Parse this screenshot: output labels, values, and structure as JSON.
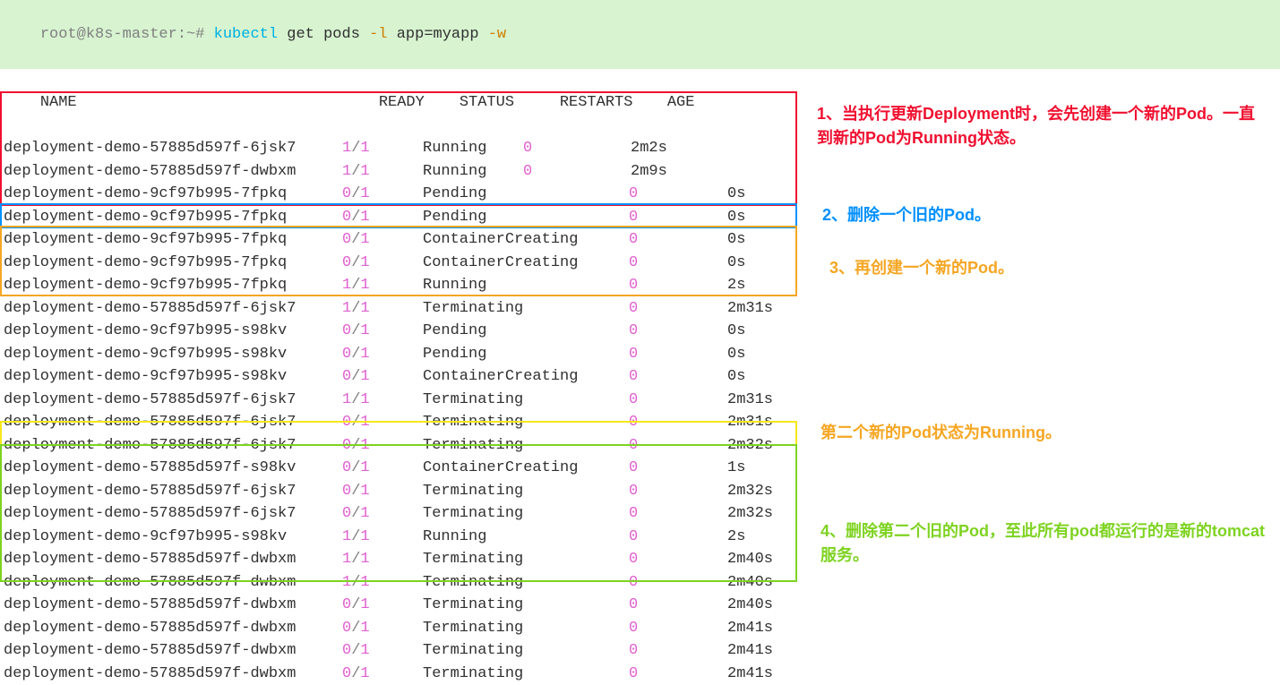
{
  "cmd_line": {
    "prompt_user": "root@k8s-master",
    "prompt_path": ":~# ",
    "cmd_kubectl": "kubectl",
    "cmd_args": " get pods ",
    "cmd_flag1": "-l",
    "cmd_args2": " app=myapp ",
    "cmd_flag2": "-w"
  },
  "headers": {
    "name": "NAME",
    "ready": "READY",
    "status": "STATUS",
    "restarts": "RESTARTS",
    "age": "AGE"
  },
  "rows_top": [
    {
      "name": "deployment-demo-57885d597f-6jsk7",
      "r1": "1",
      "r2": "1",
      "status": "Running",
      "restarts": "0",
      "age": "2m2s"
    },
    {
      "name": "deployment-demo-57885d597f-dwbxm",
      "r1": "1",
      "r2": "1",
      "status": "Running",
      "restarts": "0",
      "age": "2m9s"
    }
  ],
  "rows_wide": [
    {
      "name": "deployment-demo-9cf97b995-7fpkq",
      "r1": "0",
      "r2": "1",
      "status": "Pending",
      "restarts": "0",
      "age": "0s"
    },
    {
      "name": "deployment-demo-9cf97b995-7fpkq",
      "r1": "0",
      "r2": "1",
      "status": "Pending",
      "restarts": "0",
      "age": "0s"
    },
    {
      "name": "deployment-demo-9cf97b995-7fpkq",
      "r1": "0",
      "r2": "1",
      "status": "ContainerCreating",
      "restarts": "0",
      "age": "0s"
    },
    {
      "name": "deployment-demo-9cf97b995-7fpkq",
      "r1": "0",
      "r2": "1",
      "status": "ContainerCreating",
      "restarts": "0",
      "age": "0s"
    },
    {
      "name": "deployment-demo-9cf97b995-7fpkq",
      "r1": "1",
      "r2": "1",
      "status": "Running",
      "restarts": "0",
      "age": "2s"
    },
    {
      "name": "deployment-demo-57885d597f-6jsk7",
      "r1": "1",
      "r2": "1",
      "status": "Terminating",
      "restarts": "0",
      "age": "2m31s"
    },
    {
      "name": "deployment-demo-9cf97b995-s98kv",
      "r1": "0",
      "r2": "1",
      "status": "Pending",
      "restarts": "0",
      "age": "0s"
    },
    {
      "name": "deployment-demo-9cf97b995-s98kv",
      "r1": "0",
      "r2": "1",
      "status": "Pending",
      "restarts": "0",
      "age": "0s"
    },
    {
      "name": "deployment-demo-9cf97b995-s98kv",
      "r1": "0",
      "r2": "1",
      "status": "ContainerCreating",
      "restarts": "0",
      "age": "0s"
    },
    {
      "name": "deployment-demo-57885d597f-6jsk7",
      "r1": "1",
      "r2": "1",
      "status": "Terminating",
      "restarts": "0",
      "age": "2m31s"
    },
    {
      "name": "deployment-demo-57885d597f-6jsk7",
      "r1": "0",
      "r2": "1",
      "status": "Terminating",
      "restarts": "0",
      "age": "2m31s"
    },
    {
      "name": "deployment-demo-57885d597f-6jsk7",
      "r1": "0",
      "r2": "1",
      "status": "Terminating",
      "restarts": "0",
      "age": "2m32s"
    },
    {
      "name": "deployment-demo-57885d597f-s98kv",
      "r1": "0",
      "r2": "1",
      "status": "ContainerCreating",
      "restarts": "0",
      "age": "1s"
    },
    {
      "name": "deployment-demo-57885d597f-6jsk7",
      "r1": "0",
      "r2": "1",
      "status": "Terminating",
      "restarts": "0",
      "age": "2m32s"
    },
    {
      "name": "deployment-demo-57885d597f-6jsk7",
      "r1": "0",
      "r2": "1",
      "status": "Terminating",
      "restarts": "0",
      "age": "2m32s"
    },
    {
      "name": "deployment-demo-9cf97b995-s98kv",
      "r1": "1",
      "r2": "1",
      "status": "Running",
      "restarts": "0",
      "age": "2s"
    },
    {
      "name": "deployment-demo-57885d597f-dwbxm",
      "r1": "1",
      "r2": "1",
      "status": "Terminating",
      "restarts": "0",
      "age": "2m40s"
    },
    {
      "name": "deployment-demo-57885d597f-dwbxm",
      "r1": "1",
      "r2": "1",
      "status": "Terminating",
      "restarts": "0",
      "age": "2m40s"
    },
    {
      "name": "deployment-demo-57885d597f-dwbxm",
      "r1": "0",
      "r2": "1",
      "status": "Terminating",
      "restarts": "0",
      "age": "2m40s"
    },
    {
      "name": "deployment-demo-57885d597f-dwbxm",
      "r1": "0",
      "r2": "1",
      "status": "Terminating",
      "restarts": "0",
      "age": "2m41s"
    },
    {
      "name": "deployment-demo-57885d597f-dwbxm",
      "r1": "0",
      "r2": "1",
      "status": "Terminating",
      "restarts": "0",
      "age": "2m41s"
    },
    {
      "name": "deployment-demo-57885d597f-dwbxm",
      "r1": "0",
      "r2": "1",
      "status": "Terminating",
      "restarts": "0",
      "age": "2m41s"
    }
  ],
  "notes": {
    "n1": "1、当执行更新Deployment时，会先创建一个新的Pod。一直到新的Pod为Running状态。",
    "n2": "2、删除一个旧的Pod。",
    "n3": "3、再创建一个新的Pod。",
    "n4": "第二个新的Pod状态为Running。",
    "n5": "4、删除第二个旧的Pod，至此所有pod都运行的是新的tomcat服务。"
  }
}
